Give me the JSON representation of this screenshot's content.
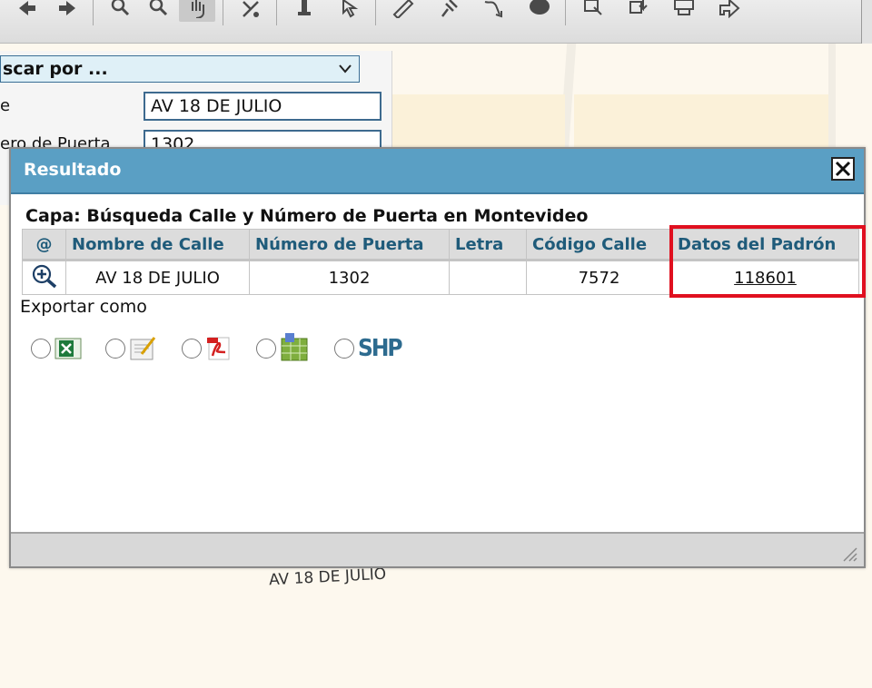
{
  "search": {
    "search_by_label": "scar por ...",
    "street_label": "e",
    "street_value": "AV 18 DE JULIO",
    "door_label": "ero de Puerta",
    "door_value": "1302"
  },
  "map": {
    "street_label": "AV 18 DE JULIO"
  },
  "modal": {
    "title": "Resultado",
    "layer_title": "Capa: Búsqueda Calle y Número de Puerta en Montevideo",
    "columns": [
      "@",
      "Nombre de Calle",
      "Número de Puerta",
      "Letra",
      "Código Calle",
      "Datos del Padrón"
    ],
    "rows": [
      {
        "nombre": "AV 18 DE JULIO",
        "numero": "1302",
        "letra": "",
        "codigo": "7572",
        "padron": "118601"
      }
    ],
    "export_label": "Exportar como",
    "export_options": [
      "excel-icon",
      "text-icon",
      "pdf-icon",
      "spreadsheet-icon",
      "shp-icon"
    ],
    "shp_text": "SHP"
  },
  "colors": {
    "header_bg": "#5a9fc4",
    "column_header_text": "#1f5b7a",
    "highlight": "#e0101f"
  }
}
